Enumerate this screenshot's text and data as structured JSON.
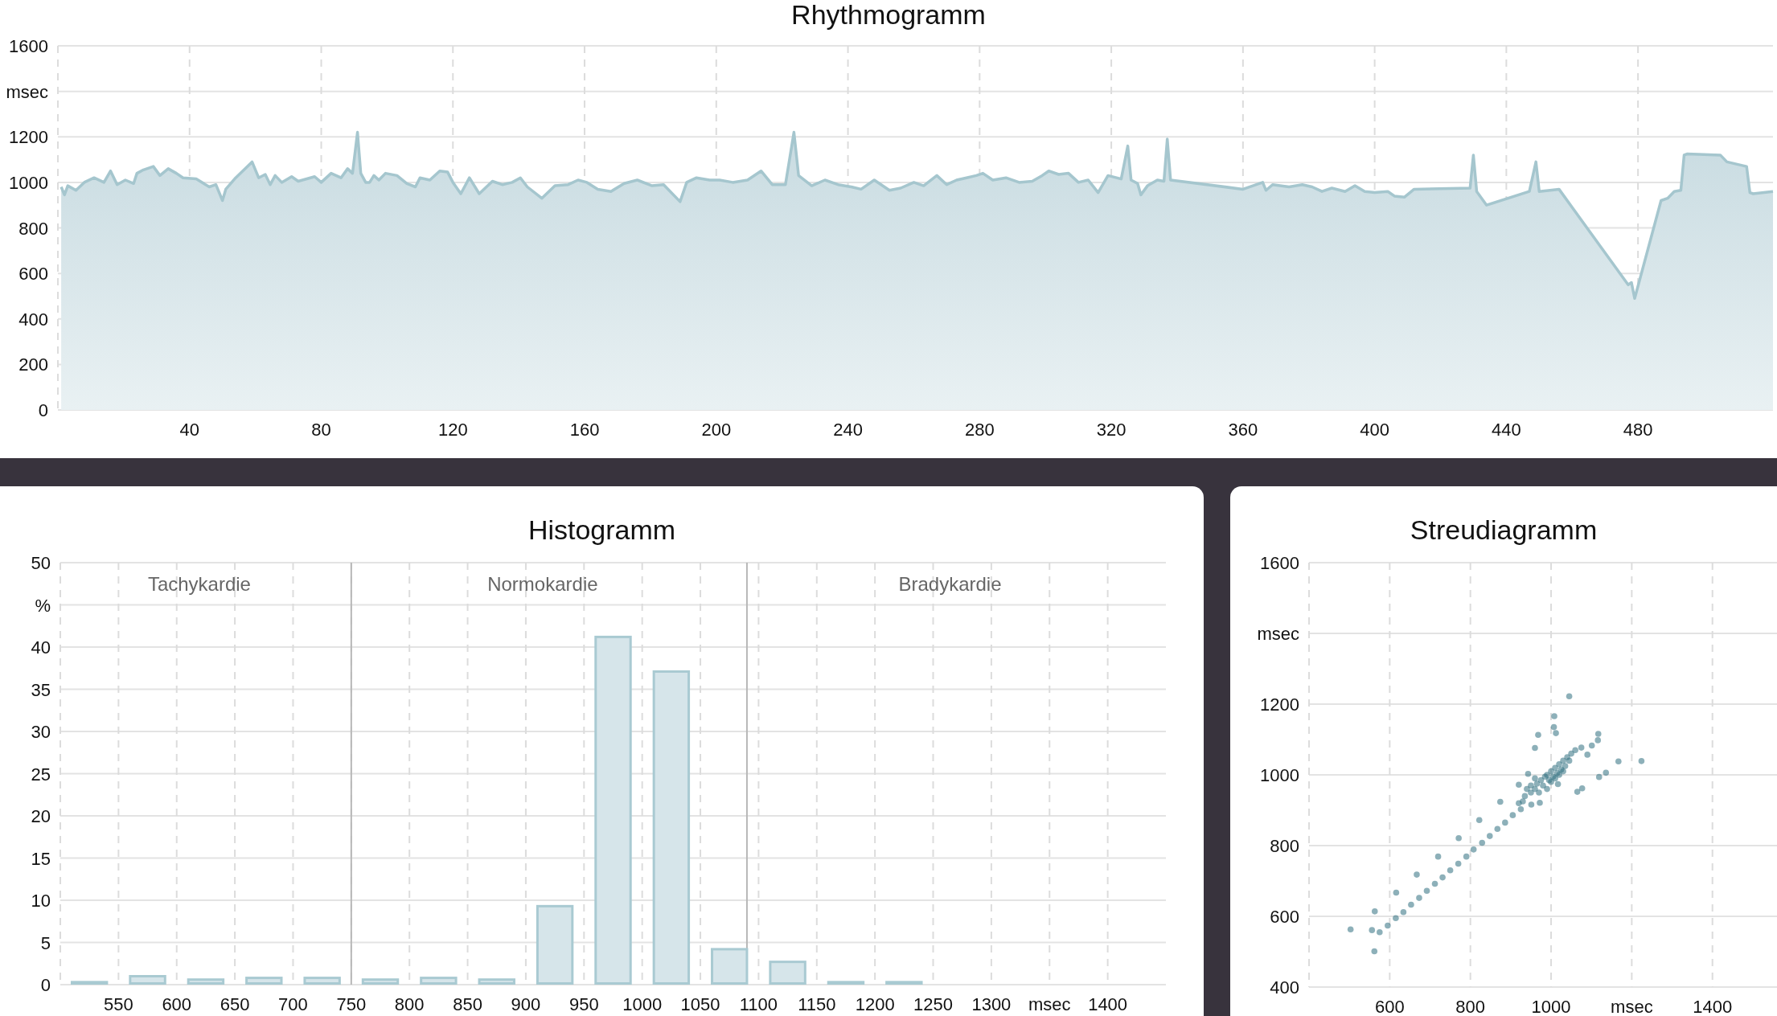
{
  "rhythmogram": {
    "title": "Rhythmogramm",
    "chart_data": {
      "type": "area",
      "x": [
        1,
        2,
        3,
        5.5,
        8,
        11,
        14,
        16,
        18,
        20.5,
        23,
        24,
        26,
        29,
        31,
        33.5,
        36,
        38,
        42,
        46,
        48,
        50,
        51,
        54,
        59,
        61,
        63,
        64.5,
        66,
        68,
        71,
        73,
        78,
        80,
        83,
        86,
        88,
        89.5,
        91,
        92,
        93.5,
        94.7,
        96,
        97.5,
        99.5,
        103,
        106,
        108.6,
        110,
        113,
        116,
        118.4,
        120,
        122.4,
        125,
        128,
        132,
        135,
        138,
        140.5,
        142.6,
        147,
        151,
        155,
        158,
        160.7,
        164,
        168,
        172,
        176,
        180.5,
        184,
        189,
        191,
        194,
        198,
        201,
        205,
        209.5,
        213.6,
        217,
        221,
        223.6,
        225,
        229,
        233,
        237,
        241,
        244,
        248,
        252.6,
        256,
        260,
        263,
        267,
        270,
        273,
        276,
        279,
        281,
        284,
        288,
        292,
        296,
        299,
        301,
        304,
        307,
        310,
        313,
        316,
        319,
        323,
        325,
        326,
        328,
        329,
        331,
        334,
        336,
        337,
        338,
        360,
        366,
        367,
        369,
        374,
        378,
        381,
        384,
        387,
        391,
        394,
        397,
        400,
        404,
        406,
        409,
        412,
        429,
        430,
        431,
        434,
        447,
        449,
        450,
        456,
        477,
        478,
        479,
        487,
        489,
        491,
        493,
        494,
        495,
        505,
        507,
        513,
        514,
        515,
        521
      ],
      "values": [
        980,
        945,
        985,
        965,
        1000,
        1020,
        1000,
        1050,
        990,
        1010,
        995,
        1040,
        1055,
        1070,
        1030,
        1060,
        1040,
        1020,
        1015,
        980,
        990,
        920,
        970,
        1020,
        1090,
        1020,
        1035,
        990,
        1030,
        1000,
        1025,
        1005,
        1025,
        1000,
        1040,
        1020,
        1060,
        1040,
        1220,
        1040,
        1000,
        1000,
        1030,
        1010,
        1040,
        1030,
        995,
        980,
        1020,
        1010,
        1050,
        1045,
        1000,
        950,
        1020,
        950,
        1005,
        990,
        1000,
        1020,
        980,
        930,
        985,
        990,
        1010,
        1000,
        970,
        960,
        995,
        1010,
        985,
        990,
        915,
        1000,
        1020,
        1010,
        1010,
        1000,
        1010,
        1050,
        990,
        990,
        1220,
        1030,
        985,
        1010,
        990,
        980,
        970,
        1010,
        965,
        975,
        1000,
        985,
        1030,
        990,
        1010,
        1020,
        1030,
        1040,
        1010,
        1020,
        1000,
        1005,
        1030,
        1050,
        1035,
        1040,
        1000,
        1010,
        955,
        1030,
        1015,
        1160,
        1010,
        995,
        945,
        985,
        1010,
        1005,
        1190,
        1010,
        970,
        1000,
        965,
        990,
        980,
        990,
        980,
        960,
        975,
        960,
        985,
        960,
        955,
        960,
        940,
        935,
        970,
        975,
        1120,
        960,
        900,
        960,
        1090,
        960,
        970,
        550,
        560,
        490,
        920,
        930,
        960,
        965,
        1120,
        1125,
        1120,
        1090,
        1070,
        955,
        950,
        960
      ],
      "xlim": [
        0,
        521
      ],
      "ylim": [
        0,
        1600
      ],
      "grid": true,
      "xticks": [
        40,
        80,
        120,
        160,
        200,
        240,
        280,
        320,
        360,
        400,
        440,
        480
      ],
      "yticks": [
        0,
        200,
        400,
        600,
        800,
        1000,
        1200,
        {
          "value": 1400,
          "label": "msec"
        },
        1600
      ]
    }
  },
  "histogram": {
    "title": "Histogramm",
    "chart_data": {
      "type": "bar",
      "x": [
        525,
        575,
        625,
        675,
        725,
        775,
        825,
        875,
        925,
        975,
        1025,
        1075,
        1125,
        1175,
        1225
      ],
      "values": [
        0.3,
        1.0,
        0.6,
        0.8,
        0.8,
        0.6,
        0.8,
        0.6,
        9.3,
        41.2,
        37.1,
        4.2,
        2.7,
        0.3,
        0.3
      ],
      "xlim": [
        500,
        1450
      ],
      "ylim": [
        0,
        50
      ],
      "xticks": [
        550,
        600,
        650,
        700,
        750,
        800,
        850,
        900,
        950,
        1000,
        1050,
        1100,
        1150,
        1200,
        1250,
        1300,
        {
          "value": 1350,
          "label": "msec"
        },
        1400
      ],
      "yticks": [
        0,
        5,
        10,
        15,
        20,
        25,
        30,
        35,
        40,
        {
          "value": 45,
          "label": "%"
        },
        50
      ],
      "grid": true,
      "ref_lines": [
        {
          "value": 750,
          "axis": "x"
        },
        {
          "value": 1090,
          "axis": "x"
        }
      ],
      "annotations": [
        "Tachykardie",
        "Normokardie",
        "Bradykardie"
      ]
    }
  },
  "scatter": {
    "title": "Streudiagramm",
    "chart_data": {
      "type": "scatter",
      "x": [
        503,
        556,
        563,
        562,
        575,
        595,
        615,
        616,
        634,
        653,
        667,
        673,
        692,
        712,
        720,
        731,
        750,
        770,
        771,
        790,
        808,
        822,
        829,
        848,
        867,
        874,
        886,
        905,
        925,
        968,
        960,
        1008,
        1007,
        1012,
        1045,
        1117,
        1116,
        1101,
        1090,
        1075,
        1167,
        1224,
        1136,
        1119,
        1065,
        1077,
        1017,
        972,
        951,
        943,
        920,
        920,
        935,
        950,
        960,
        965,
        975,
        980,
        985,
        990,
        995,
        1000,
        1005,
        1010,
        1015,
        1020,
        1025,
        1030,
        1035,
        1040,
        1045,
        950,
        970,
        990,
        1000,
        1010,
        1020,
        1030,
        960,
        940,
        930,
        1050,
        1060
      ],
      "values": [
        563,
        561,
        614,
        501,
        555,
        574,
        595,
        667,
        612,
        633,
        718,
        652,
        672,
        692,
        769,
        710,
        730,
        749,
        821,
        769,
        789,
        872,
        808,
        827,
        847,
        924,
        865,
        886,
        903,
        1113,
        1076,
        1166,
        1135,
        1118,
        1222,
        1116,
        1098,
        1083,
        1057,
        1077,
        1038,
        1039,
        1006,
        994,
        952,
        962,
        974,
        921,
        916,
        1003,
        972,
        920,
        940,
        950,
        960,
        975,
        985,
        970,
        995,
        1000,
        985,
        1010,
        995,
        1020,
        1005,
        1030,
        1015,
        1040,
        1025,
        1050,
        1040,
        970,
        950,
        960,
        980,
        990,
        1000,
        1010,
        990,
        960,
        925,
        1060,
        1070
      ],
      "grid": true,
      "xlim": [
        400,
        1560
      ],
      "ylim": [
        400,
        1600
      ],
      "xticks": [
        600,
        800,
        1000,
        {
          "value": 1200,
          "label": "msec"
        },
        1400
      ],
      "yticks": [
        400,
        600,
        800,
        1000,
        1200,
        {
          "value": 1400,
          "label": "msec"
        },
        1600
      ]
    }
  }
}
